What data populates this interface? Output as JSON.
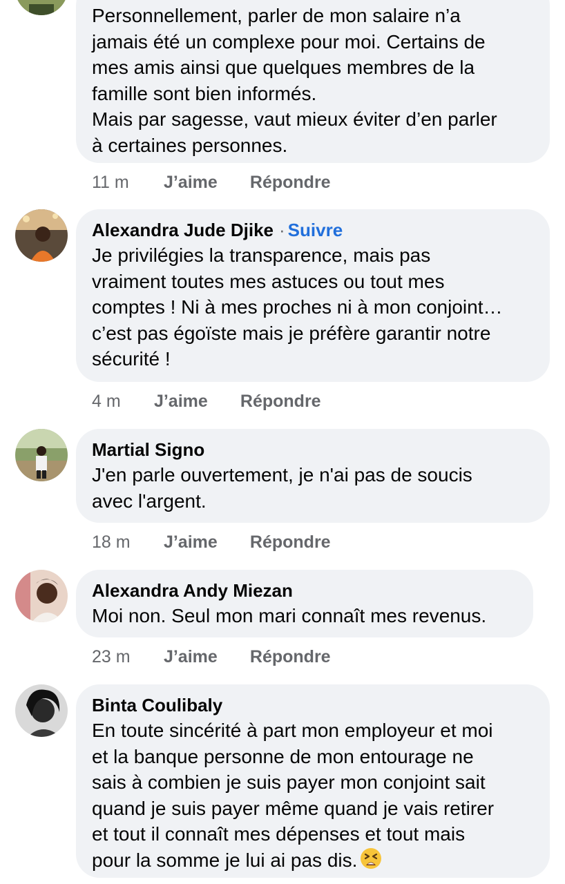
{
  "comments": [
    {
      "author": "",
      "text": "Personnellement, parler de mon salaire n’a\njamais été un complexe pour moi. Certains de\nmes amis ainsi que quelques membres de la\nfamille sont bien informés.\nMais par sagesse, vaut mieux éviter d’en parler\nà certaines personnes.",
      "time": "11 m",
      "like": "J’aime",
      "reply": "Répondre"
    },
    {
      "author": "Alexandra Jude Djike",
      "follow_sep": "·",
      "follow": "Suivre",
      "text": "Je privilégies la transparence, mais pas\nvraiment toutes mes astuces ou tout mes\ncomptes ! Ni à mes proches ni à mon conjoint…\nc’est pas égoïste mais je préfère garantir notre\nsécurité !",
      "time": "4 m",
      "like": "J’aime",
      "reply": "Répondre"
    },
    {
      "author": "Martial Signo",
      "text": "J'en parle ouvertement, je n'ai pas de soucis\navec l'argent.",
      "time": "18 m",
      "like": "J’aime",
      "reply": "Répondre"
    },
    {
      "author": "Alexandra Andy Miezan",
      "text": "Moi non. Seul mon mari connaît mes revenus.",
      "time": "23 m",
      "like": "J’aime",
      "reply": "Répondre"
    },
    {
      "author": "Binta Coulibaly",
      "text": "En toute sincérité à part mon employeur et moi\net la banque personne de mon entourage ne\nsais à combien je suis payer mon conjoint sait\nquand je suis payer même quand je vais retirer\net tout il connaît mes dépenses et tout mais\npour la somme je lui ai pas dis.",
      "emoji": "tired-face-emoji"
    }
  ],
  "colors": {
    "bubble": "#f0f2f5",
    "text": "#050505",
    "meta": "#65676b",
    "link": "#216fdb"
  }
}
